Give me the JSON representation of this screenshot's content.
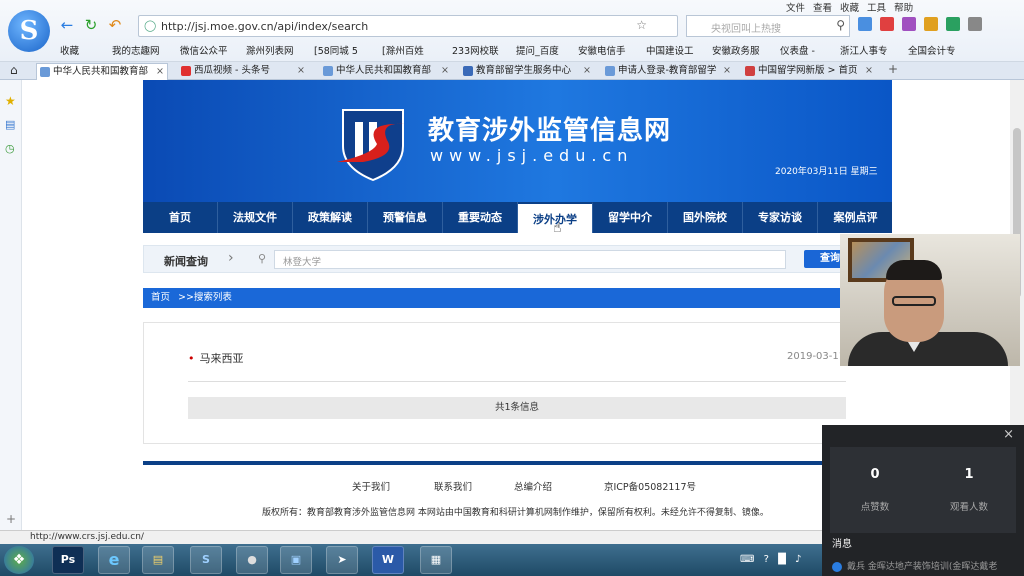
{
  "browser": {
    "url": "http://jsj.moe.gov.cn/api/index/search",
    "search_placeholder": "央视回叫上热搜",
    "menu": [
      "文件",
      "查看",
      "收藏",
      "工具",
      "帮助"
    ],
    "favorites": [
      "收藏",
      "我的志趣网",
      "微信公众平",
      "滁州列表网",
      "[58同城 5",
      "[滁州百姓",
      "233网校联",
      "提问_百度",
      "安徽电信手",
      "中国建设工",
      "安徽政务服",
      "仪表盘 -",
      "浙江人事专",
      "全国会计专"
    ],
    "tabs": [
      {
        "label": "中华人民共和国教育部",
        "active": true
      },
      {
        "label": "西瓜视频 - 头条号",
        "active": false
      },
      {
        "label": "中华人民共和国教育部",
        "active": false
      },
      {
        "label": "教育部留学生服务中心",
        "active": false
      },
      {
        "label": "申请人登录-教育部留学",
        "active": false
      },
      {
        "label": "中国留学网新版 > 首页",
        "active": false
      }
    ],
    "status_url": "http://www.crs.jsj.edu.cn/"
  },
  "site": {
    "title": "教育涉外监管信息网",
    "url_text": "www.jsj.edu.cn",
    "date": "2020年03月11日 星期三",
    "nav": [
      "首页",
      "法规文件",
      "政策解读",
      "预警信息",
      "重要动态",
      "涉外办学",
      "留学中介",
      "国外院校",
      "专家访谈",
      "案例点评"
    ],
    "nav_active": "涉外办学",
    "news_query_label": "新闻查询",
    "news_query_placeholder": "林登大学",
    "query_button": "查询",
    "breadcrumb": [
      "首页",
      ">>搜索列表"
    ],
    "results": [
      {
        "title": "马来西亚",
        "date": "2019-03-11"
      }
    ],
    "result_count": "共1条信息",
    "footer_links": [
      "关于我们",
      "联系我们",
      "总编介绍",
      "京ICP备05082117号"
    ],
    "copyright": "版权所有：教育部教育涉外监管信息网 本网站由中国教育和科研计算机网制作维护，保留所有权利。未经允许不得复制、镜像。"
  },
  "live": {
    "likes": "0",
    "likes_label": "点赞数",
    "viewers": "1",
    "viewers_label": "观看人数",
    "messages_label": "消息",
    "message_preview": "戴兵 金晖达地产装饰培训(金晖达戴老"
  },
  "colors": {
    "banner_blue": "#1f78e0",
    "nav_dark": "#0b3f86",
    "accent": "#1a68d8"
  }
}
